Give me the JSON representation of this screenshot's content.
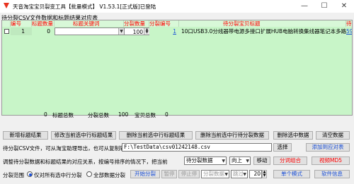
{
  "window": {
    "title": "天音淘宝宝贝裂变工具【批量模式】 V1.53.1[正式版]已登陆",
    "controls": {
      "minimize": "—",
      "maximize": "☐",
      "close": "✕"
    },
    "accent_color": "#ff0000",
    "grid_color": "#c8f5c8",
    "link_color": "#1a4fd6"
  },
  "section_title": "待分裂CSV文件数据和标题结果对应表",
  "grid": {
    "headers": {
      "index": "编号",
      "title_count": "标题数量",
      "keywords": "标题关键词",
      "split_qty": "分裂数量",
      "split_id": "分裂编号",
      "item_title": "待分裂宝贝标题",
      "link": "待"
    },
    "row": {
      "checked": false,
      "index": "1",
      "title_count": "0",
      "keywords": "",
      "split_qty": "100",
      "split_id": "1",
      "item_title": "10口USB3.0分线器带电源多接口扩展HUB电脑转换集线器笔记本多路",
      "link": "59"
    },
    "summary": {
      "title_total": "0",
      "title_total_label": "标题总数",
      "split_total_label": "分裂总数",
      "split_total": "100",
      "item_total_label": "宝贝总数",
      "item_total": "0"
    }
  },
  "buttons_row1": {
    "add_title": "新增标题结果",
    "edit_title": "修改当前选中行标题结果",
    "delete_title": "删除当前选中行标题结果",
    "delete_split": "删除当前选中行待分裂数据",
    "delete_data": "删除选中数据",
    "clear_data": "清空数据"
  },
  "csv_row": {
    "label": "待分裂CSV文件，可从淘宝助理导出，也可从复制软件下载",
    "path": "F:\\TestData\\csv01242148.csv",
    "choose_button": "选择",
    "add_to_table_button": "添加到应对表"
  },
  "adjust_row": {
    "label": "调整待分裂数据和标题结果的对应关系，按编号排序的情况下，把当前",
    "select1": "待分裂数据",
    "select2": "向上",
    "move_button": "移动",
    "combine_button": "分词组合",
    "video_button": "视频MD5"
  },
  "split_row": {
    "range_label": "分裂范围",
    "radio1_label": "仅对所有选中行分裂",
    "radio2_label": "全部数据分裂",
    "radio1_checked": true,
    "radio2_checked": false,
    "start_button": "开始分裂",
    "pause_button": "暂停",
    "stop_button": "停止停",
    "select3": "分裂数据",
    "select4": "跳过",
    "spin_value": "20",
    "single_mode_button": "单个模式",
    "software_info_button": "软件信息"
  }
}
